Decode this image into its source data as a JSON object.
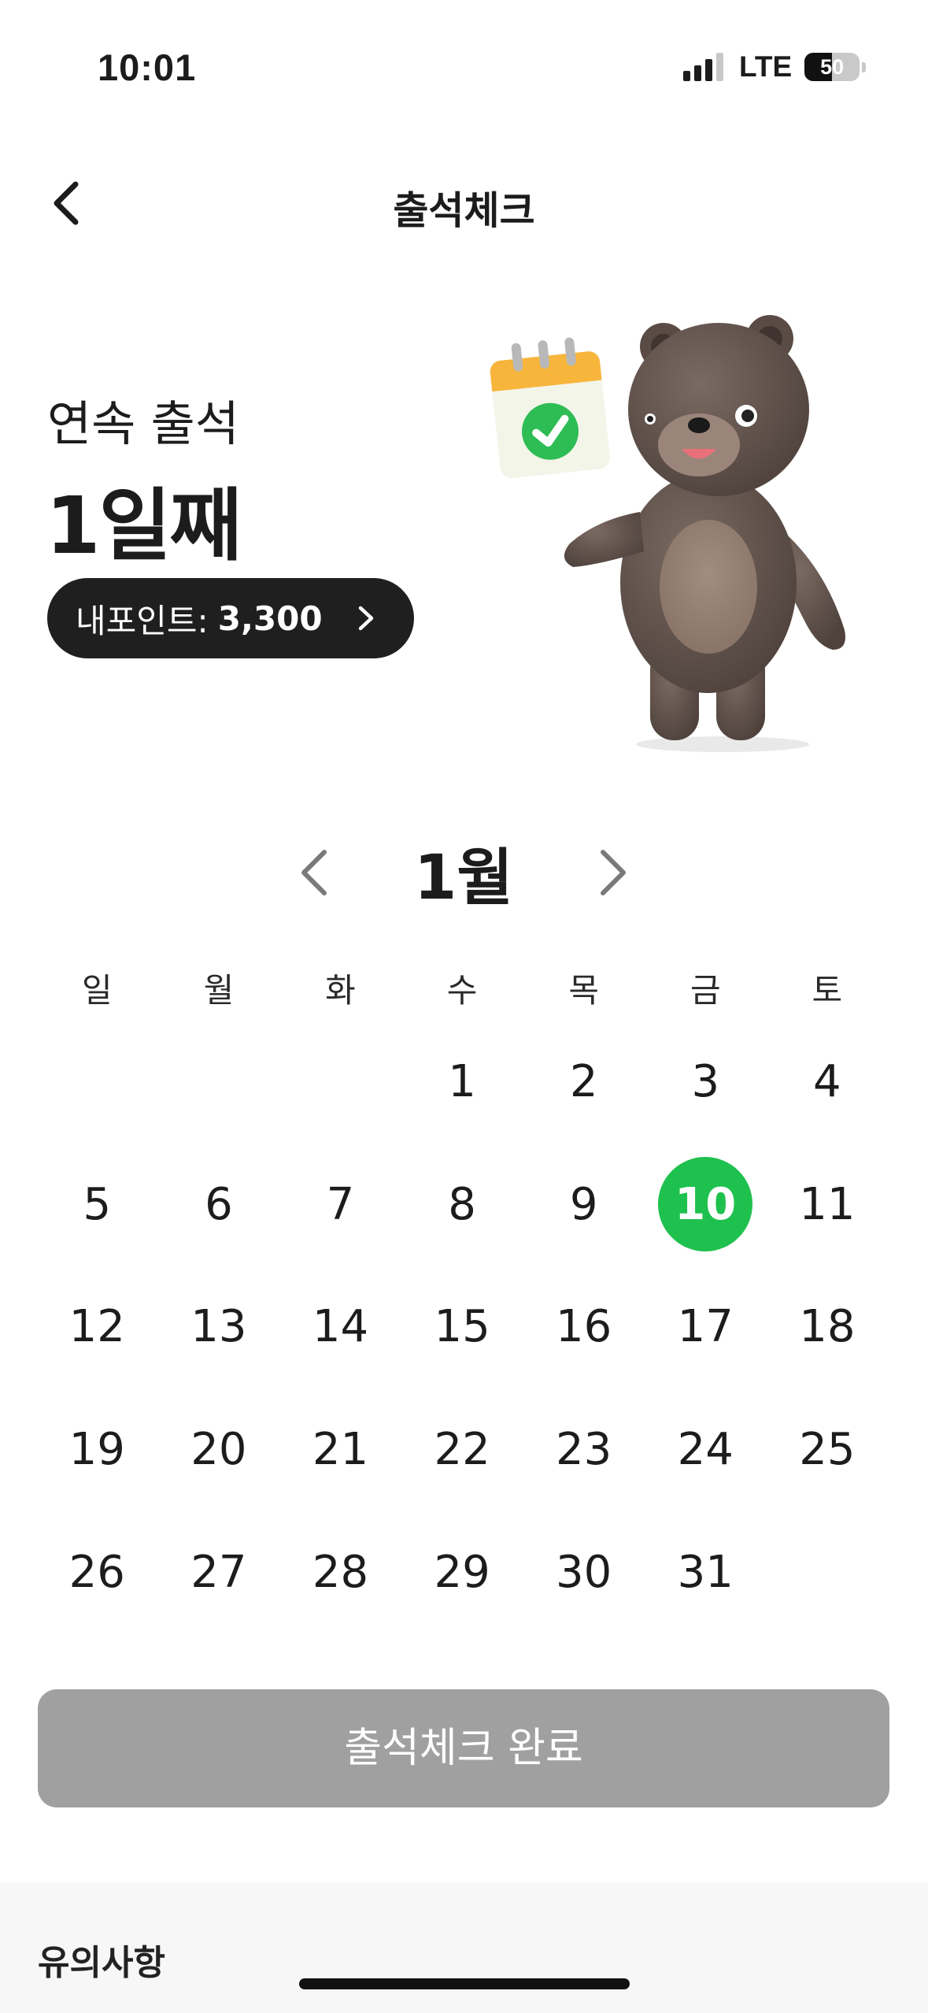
{
  "status_bar": {
    "time": "10:01",
    "network": "LTE",
    "battery_level": "50",
    "battery_fraction": 0.5,
    "signal_bars_active": 3,
    "signal_bars_total": 4
  },
  "header": {
    "title": "출석체크",
    "back_icon": "chevron-left-icon"
  },
  "streak": {
    "label": "연속 출석",
    "days": "1일째"
  },
  "points": {
    "label": "내포인트:",
    "value": "3,300",
    "chevron_icon": "chevron-right-icon"
  },
  "calendar": {
    "month": "1월",
    "weekdays": [
      "일",
      "월",
      "화",
      "수",
      "목",
      "금",
      "토"
    ],
    "leading_blanks": 3,
    "days_in_month": 31,
    "today": 10,
    "today_color": "#1fc14e"
  },
  "complete_button": {
    "label": "출석체크 완료",
    "color": "#a0a0a0"
  },
  "notice": {
    "title": "유의사항"
  }
}
